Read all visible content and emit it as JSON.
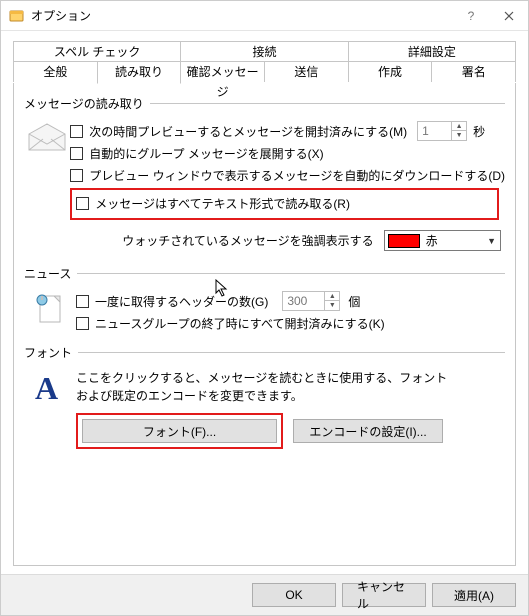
{
  "window": {
    "title": "オプション"
  },
  "tabs": {
    "row1": [
      "スペル チェック",
      "接続",
      "詳細設定"
    ],
    "row2": [
      "全般",
      "読み取り",
      "確認メッセージ",
      "送信",
      "作成",
      "署名"
    ],
    "active": "読み取り"
  },
  "groups": {
    "read": {
      "title": "メッセージの読み取り",
      "chk1": "次の時間プレビューするとメッセージを開封済みにする(M)",
      "spin1": "1",
      "sec": "秒",
      "chk2": "自動的にグループ メッセージを展開する(X)",
      "chk3": "プレビュー ウィンドウで表示するメッセージを自動的にダウンロードする(D)",
      "chk4": "メッセージはすべてテキスト形式で読み取る(R)",
      "watch_label": "ウォッチされているメッセージを強調表示する",
      "watch_color": "赤"
    },
    "news": {
      "title": "ニュース",
      "chk1": "一度に取得するヘッダーの数(G)",
      "spin1": "300",
      "unit": "個",
      "chk2": "ニュースグループの終了時にすべて開封済みにする(K)"
    },
    "font": {
      "title": "フォント",
      "desc": "ここをクリックすると、メッセージを読むときに使用する、フォントおよび既定のエンコードを変更できます。",
      "btn_font": "フォント(F)...",
      "btn_enc": "エンコードの設定(I)..."
    }
  },
  "footer": {
    "ok": "OK",
    "cancel": "キャンセル",
    "apply": "適用(A)"
  }
}
